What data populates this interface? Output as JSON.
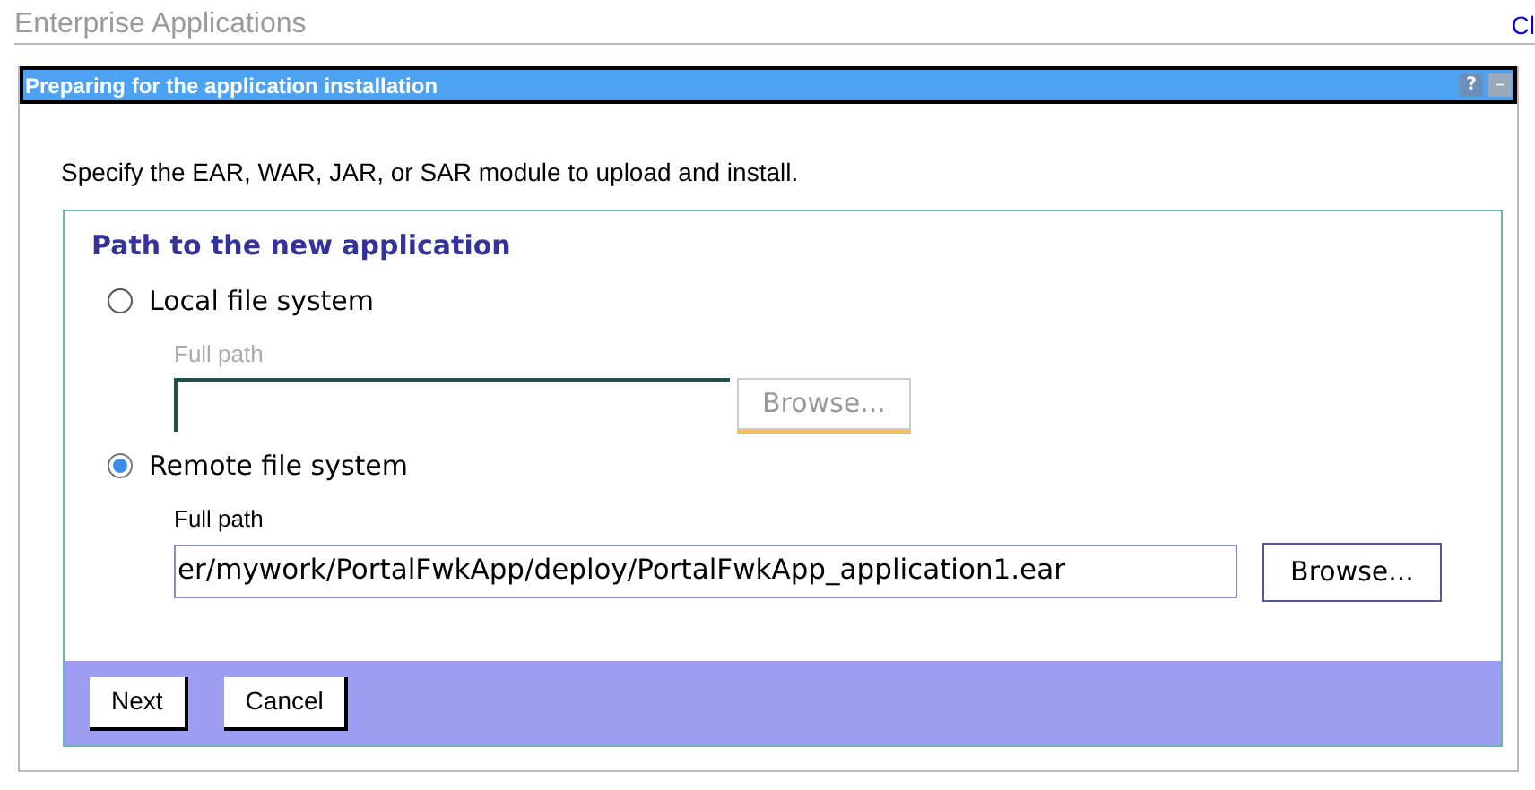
{
  "page_title": "Enterprise Applications",
  "corner_link": "Cl",
  "panel": {
    "title": "Preparing for the application installation",
    "help_icon": "?",
    "minimize_icon": "–"
  },
  "instruction": "Specify the EAR, WAR, JAR, or SAR module to upload and install.",
  "section_title": "Path to the new application",
  "options": [
    {
      "label": "Local file system",
      "selected": false,
      "field_label": "Full path",
      "disabled": true,
      "browse": "Browse..."
    },
    {
      "label": "Remote file system",
      "selected": true,
      "field_label": "Full path",
      "value": "er/mywork/PortalFwkApp/deploy/PortalFwkApp_application1.ear",
      "disabled": false,
      "browse": "Browse..."
    }
  ],
  "buttons": [
    "Next",
    "Cancel"
  ]
}
